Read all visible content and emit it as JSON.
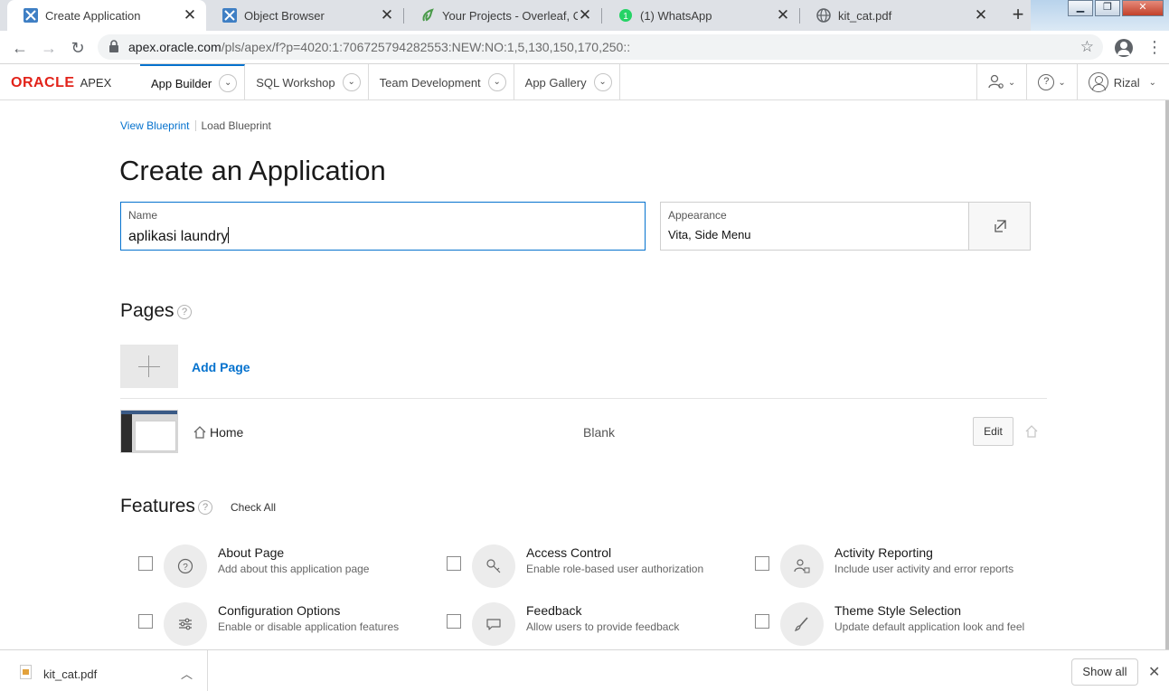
{
  "browser": {
    "tabs": [
      {
        "title": "Create Application",
        "active": true
      },
      {
        "title": "Object Browser",
        "active": false
      },
      {
        "title": "Your Projects - Overleaf, Onli",
        "active": false
      },
      {
        "title": "(1) WhatsApp",
        "active": false
      },
      {
        "title": "kit_cat.pdf",
        "active": false
      }
    ],
    "url_host": "apex.oracle.com",
    "url_path": "/pls/apex/f?p=4020:1:706725794282553:NEW:NO:1,5,130,150,170,250::"
  },
  "apex_header": {
    "brand": "ORACLE",
    "product": "APEX",
    "nav": [
      "App Builder",
      "SQL Workshop",
      "Team Development",
      "App Gallery"
    ],
    "user": "Rizal"
  },
  "breadcrumbs": {
    "view": "View Blueprint",
    "load": "Load Blueprint"
  },
  "page_title": "Create an Application",
  "name_field": {
    "label": "Name",
    "value": "aplikasi laundry"
  },
  "appearance_field": {
    "label": "Appearance",
    "value": "Vita, Side Menu"
  },
  "pages": {
    "title": "Pages",
    "add_label": "Add Page",
    "rows": [
      {
        "name": "Home",
        "type": "Blank",
        "edit_label": "Edit"
      }
    ]
  },
  "features": {
    "title": "Features",
    "check_all": "Check All",
    "items": [
      {
        "title": "About Page",
        "desc": "Add about this application page",
        "icon": "help-circle-icon"
      },
      {
        "title": "Access Control",
        "desc": "Enable role-based user authorization",
        "icon": "key-icon"
      },
      {
        "title": "Activity Reporting",
        "desc": "Include user activity and error reports",
        "icon": "user-chart-icon"
      },
      {
        "title": "Configuration Options",
        "desc": "Enable or disable application features",
        "icon": "sliders-icon"
      },
      {
        "title": "Feedback",
        "desc": "Allow users to provide feedback",
        "icon": "comment-icon"
      },
      {
        "title": "Theme Style Selection",
        "desc": "Update default application look and feel",
        "icon": "brush-icon"
      }
    ]
  },
  "downloads": {
    "file": "kit_cat.pdf",
    "show_all": "Show all"
  },
  "colors": {
    "accent": "#0572ce",
    "oracle_red": "#e2231a"
  }
}
